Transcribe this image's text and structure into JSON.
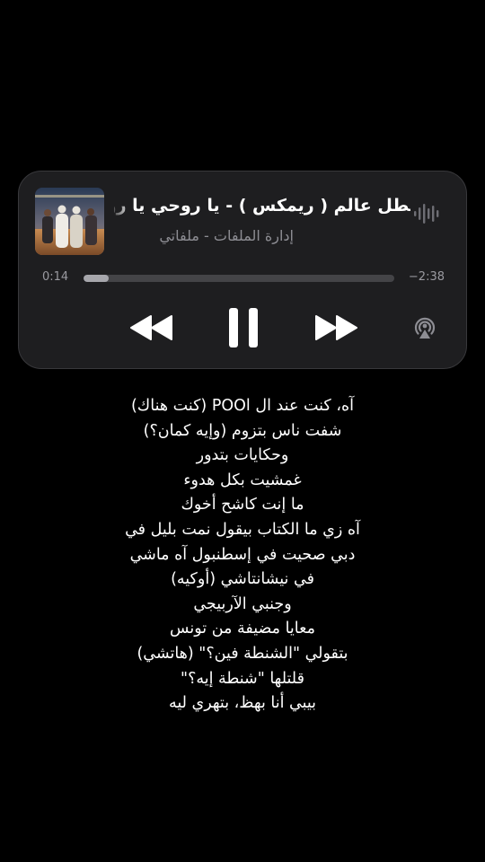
{
  "player": {
    "title": "بطل عالم ( ريمكس ) - يا روحي يا روحي",
    "subtitle": "إدارة الملفات - ملفاتي",
    "time_elapsed": "0:14",
    "time_remaining": "−2:38",
    "progress": 0.08,
    "icons": {
      "waveform": "waveform-icon",
      "rewind": "backward-icon",
      "pause": "pause-icon",
      "forward": "forward-icon",
      "airplay": "airplay-icon"
    },
    "colors": {
      "card_background": "#1e1e20",
      "text_primary": "#ffffff",
      "text_secondary": "#8d8d93",
      "progress_fill": "#a6a6ab",
      "progress_track": "#444447"
    }
  },
  "lyrics": [
    "آه، كنت عند ال POOl (كنت هناك)",
    "شفت ناس بتزوم (وإيه كمان؟)",
    "وحكايات بتدور",
    "غمشيت بكل هدوء",
    "ما إنت كاشح أخوك",
    "آه زي ما الكتاب بيقول نمت بليل في",
    "دبي صحيت في إسطنبول آه ماشي",
    "في نيشانتاشي (أوكيه)",
    "وجنبي الآربيجي",
    "معايا مضيفة من تونس",
    "بتقولي \"الشنطة فين؟\" (هاتشي)",
    "قلتلها \"شنطة إيه؟\"",
    "بيبي أنا بهظ، بتهري ليه"
  ]
}
